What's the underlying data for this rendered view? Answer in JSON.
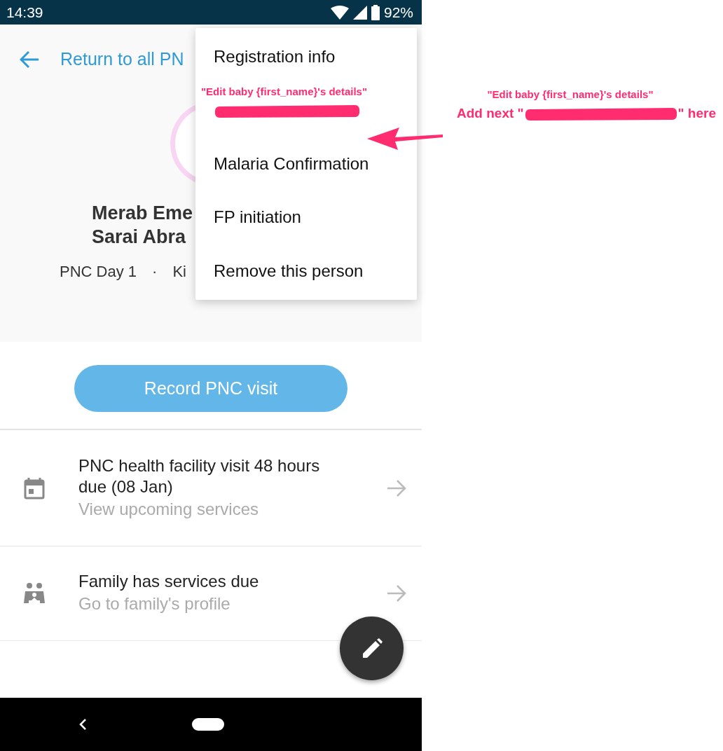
{
  "status_bar": {
    "time": "14:39",
    "battery": "92%"
  },
  "header": {
    "back_label": "Return to all PN"
  },
  "profile": {
    "name_lines": [
      "Merab Eme",
      "Sarai Abra"
    ],
    "meta": [
      "PNC Day 1",
      "·",
      "Ki"
    ]
  },
  "record_button": "Record PNC visit",
  "services": [
    {
      "kind": "calendar",
      "title": "PNC health facility visit 48 hours due (08 Jan)",
      "subtitle": "View upcoming services"
    },
    {
      "kind": "family",
      "title": "Family has services due",
      "subtitle": "Go to family's profile"
    }
  ],
  "menu": [
    {
      "kind": "text",
      "label": "Registration info"
    },
    {
      "kind": "redacted",
      "note": "\"Edit baby {first_name}'s details\""
    },
    {
      "kind": "text",
      "label": "Malaria Confirmation"
    },
    {
      "kind": "text",
      "label": "FP initiation"
    },
    {
      "kind": "text",
      "label": "Remove this person"
    }
  ],
  "annotation": {
    "caption": "\"Edit baby {first_name}'s details\"",
    "before": "Add  next \"",
    "after": "\" here"
  }
}
